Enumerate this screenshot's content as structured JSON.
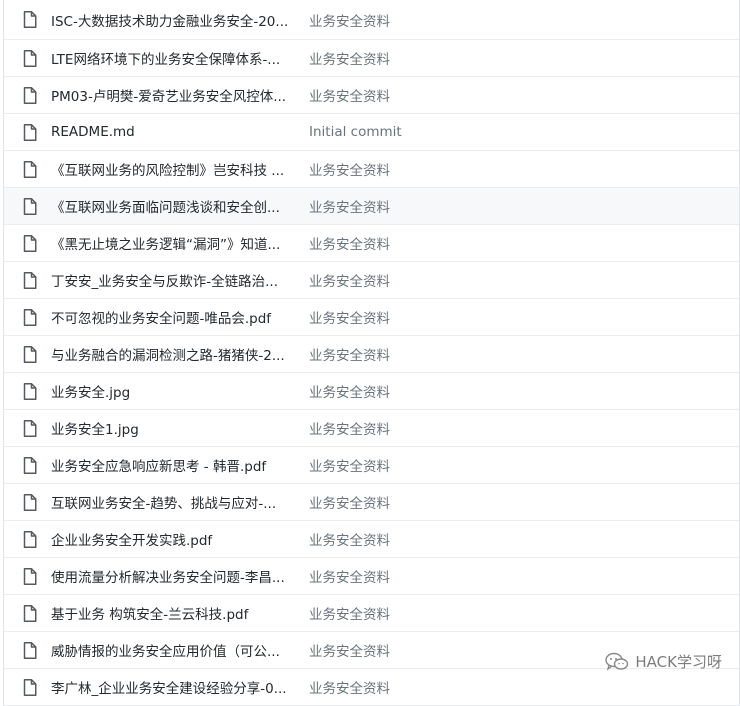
{
  "files": [
    {
      "name": "ISC-大数据技术助力金融业务安全-20...",
      "commit": "业务安全资料"
    },
    {
      "name": "LTE网络环境下的业务安全保障体系-...",
      "commit": "业务安全资料"
    },
    {
      "name": "PM03-卢明樊-爱奇艺业务安全风控体...",
      "commit": "业务安全资料"
    },
    {
      "name": "README.md",
      "commit": "Initial commit"
    },
    {
      "name": "《互联网业务的风险控制》岂安科技 ...",
      "commit": "业务安全资料"
    },
    {
      "name": "《互联网业务面临问题浅谈和安全创...",
      "commit": "业务安全资料"
    },
    {
      "name": "《黑无止境之业务逻辑“漏洞”》知道...",
      "commit": "业务安全资料"
    },
    {
      "name": "丁安安_业务安全与反欺诈-全链路治...",
      "commit": "业务安全资料"
    },
    {
      "name": "不可忽视的业务安全问题-唯品会.pdf",
      "commit": "业务安全资料"
    },
    {
      "name": "与业务融合的漏洞检测之路-猪猪侠-2...",
      "commit": "业务安全资料"
    },
    {
      "name": "业务安全.jpg",
      "commit": "业务安全资料"
    },
    {
      "name": "业务安全1.jpg",
      "commit": "业务安全资料"
    },
    {
      "name": "业务安全应急响应新思考 - 韩晋.pdf",
      "commit": "业务安全资料"
    },
    {
      "name": "互联网业务安全-趋势、挑战与应对-...",
      "commit": "业务安全资料"
    },
    {
      "name": "企业业务安全开发实践.pdf",
      "commit": "业务安全资料"
    },
    {
      "name": "使用流量分析解决业务安全问题-李昌...",
      "commit": "业务安全资料"
    },
    {
      "name": "基于业务 构筑安全-兰云科技.pdf",
      "commit": "业务安全资料"
    },
    {
      "name": "威胁情报的业务安全应用价值（可公...",
      "commit": "业务安全资料"
    },
    {
      "name": "李广林_企业业务安全建设经验分享-0...",
      "commit": "业务安全资料"
    }
  ],
  "icons": {
    "file": "file-icon",
    "watermark": "wechat-icon"
  },
  "watermark": {
    "text": "HACK学习呀"
  },
  "colors": {
    "highlight_row": "#f6f8fa",
    "border": "#eaecef",
    "name_text": "#24292e",
    "commit_text": "#6a737d"
  }
}
